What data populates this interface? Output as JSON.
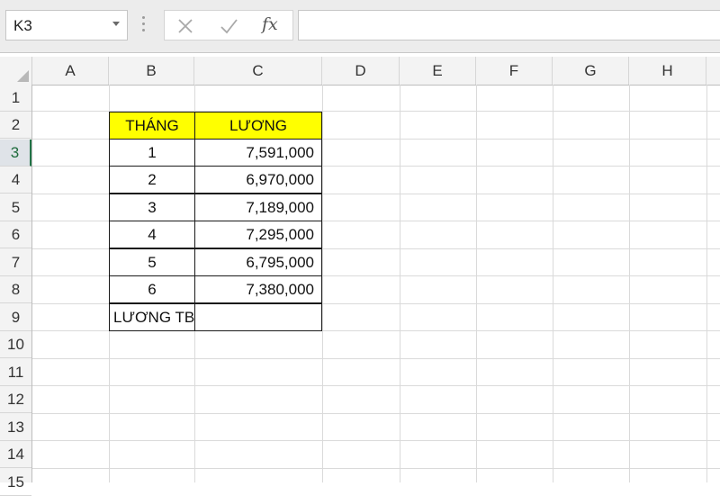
{
  "formula_bar": {
    "name_box": "K3",
    "cancel_icon": "close-icon",
    "enter_icon": "check-icon",
    "fx_label": "fx",
    "formula": ""
  },
  "columns": [
    "A",
    "B",
    "C",
    "D",
    "E",
    "F",
    "G",
    "H"
  ],
  "rows": [
    "1",
    "2",
    "3",
    "4",
    "5",
    "6",
    "7",
    "8",
    "9",
    "10",
    "11",
    "12",
    "13",
    "14",
    "15"
  ],
  "active_row": "3",
  "table": {
    "header": {
      "month": "THÁNG",
      "salary": "LƯƠNG"
    },
    "rows": [
      {
        "month": "1",
        "salary": "7,591,000"
      },
      {
        "month": "2",
        "salary": "6,970,000"
      },
      {
        "month": "3",
        "salary": "7,189,000"
      },
      {
        "month": "4",
        "salary": "7,295,000"
      },
      {
        "month": "5",
        "salary": "6,795,000"
      },
      {
        "month": "6",
        "salary": "7,380,000"
      }
    ],
    "footer": {
      "label": "LƯƠNG TB",
      "value": ""
    }
  },
  "colors": {
    "header_fill": "#ffff00",
    "active_accent": "#217346"
  }
}
